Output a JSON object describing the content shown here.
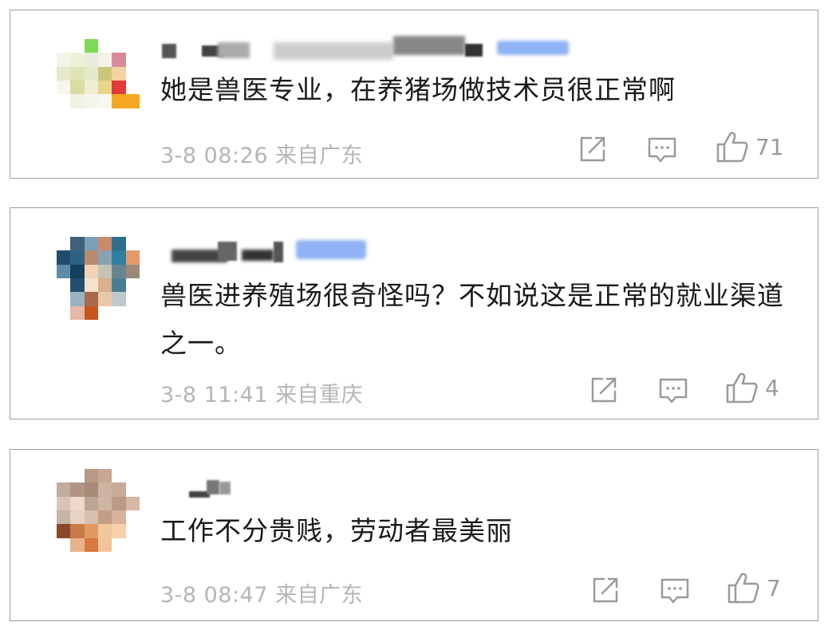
{
  "comments": [
    {
      "text": "她是兽医专业，在养猪场做技术员很正常啊",
      "meta": "3-8 08:26 来自广东",
      "likes": "71",
      "icons": [
        "share-icon",
        "comment-icon",
        "thumbs-up-icon"
      ]
    },
    {
      "text": "兽医进养殖场很奇怪吗？不如说这是正常的就业渠道之一。",
      "meta": "3-8 11:41 来自重庆",
      "likes": "4",
      "icons": [
        "share-icon",
        "comment-icon",
        "thumbs-up-icon"
      ]
    },
    {
      "text": "工作不分贵贱，劳动者最美丽",
      "meta": "3-8 08:47 来自广东",
      "likes": "7",
      "icons": [
        "share-icon",
        "comment-icon",
        "thumbs-up-icon"
      ]
    }
  ],
  "colors": {
    "text": "#1a1a1a",
    "meta": "#b5b5b5",
    "icon": "#9a9a9a",
    "border": "#9e9e9e",
    "vip_badge": "#8fb3f5"
  }
}
